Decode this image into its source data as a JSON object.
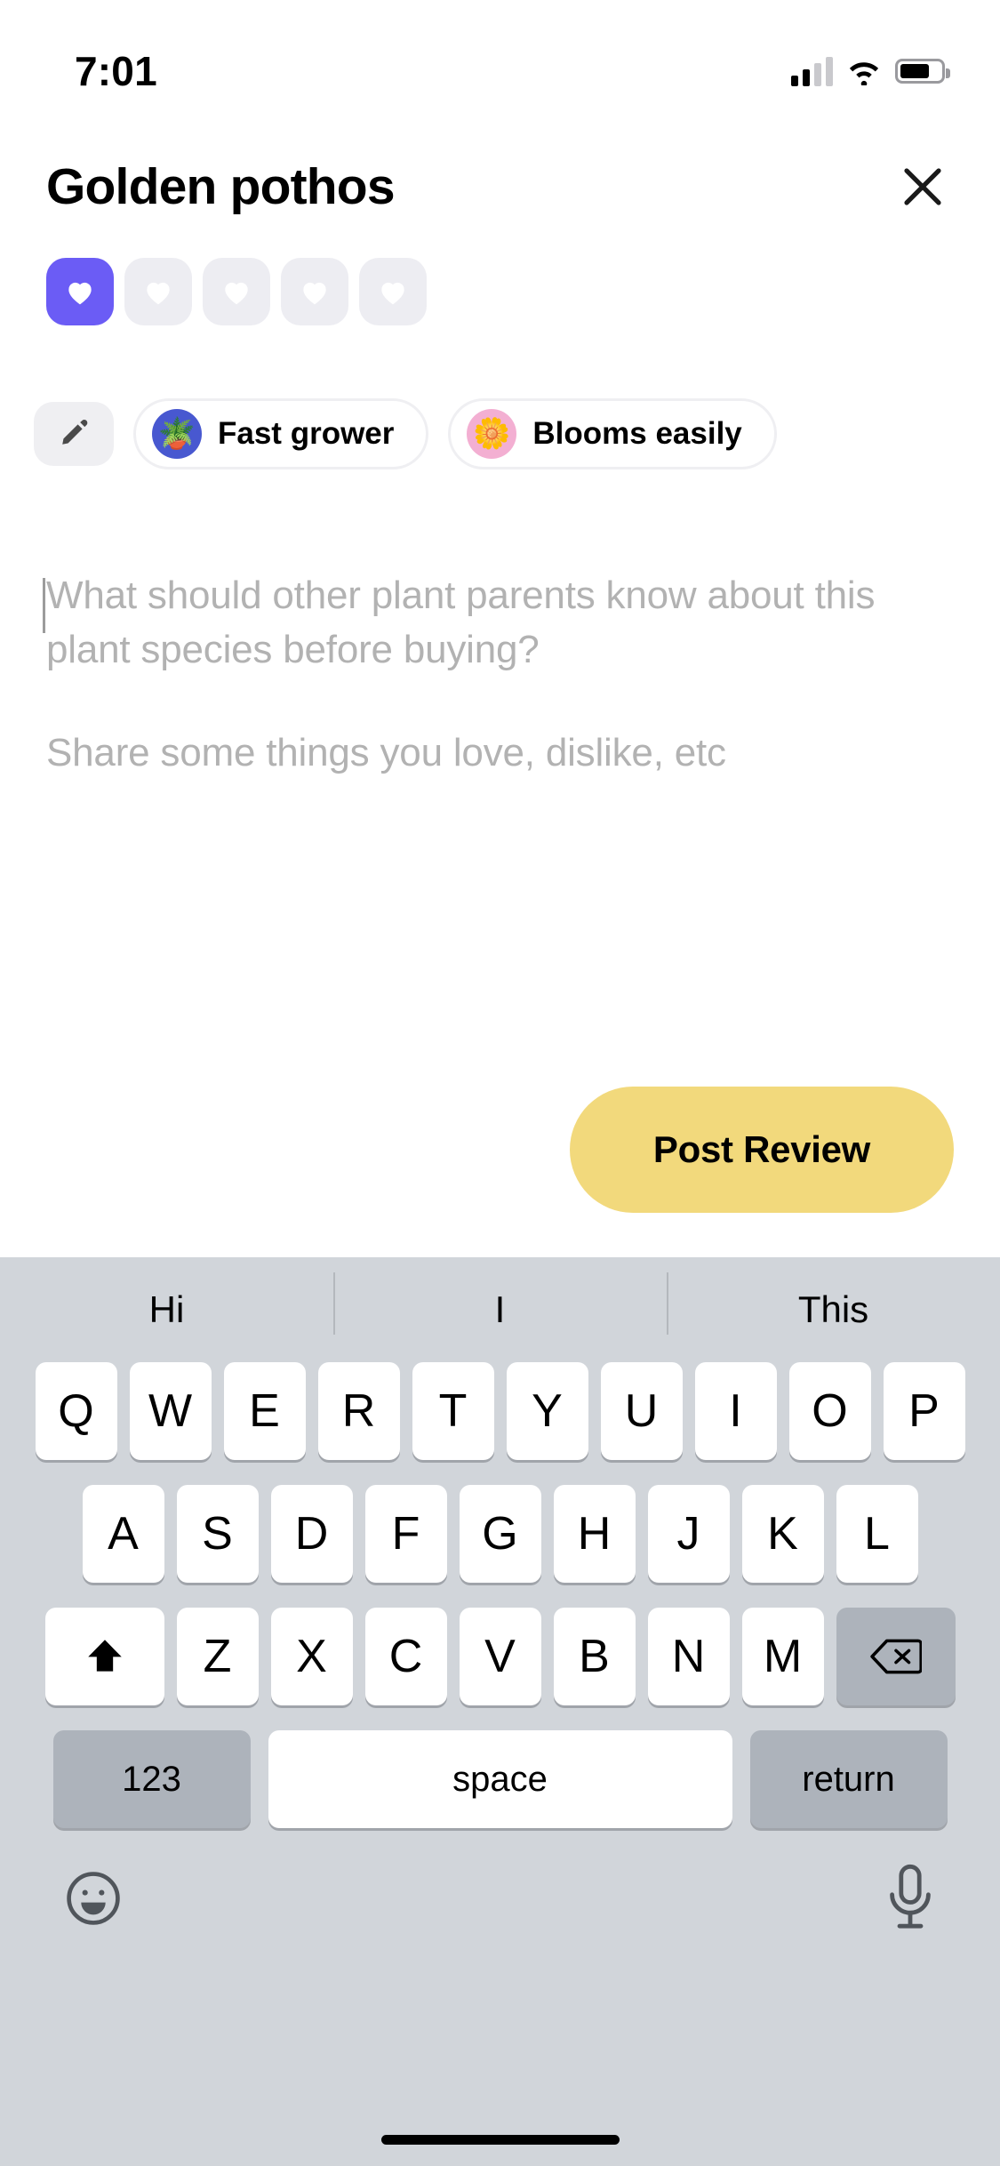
{
  "status_bar": {
    "time": "7:01",
    "cellular_icon": "cellular-signal-icon",
    "wifi_icon": "wifi-icon",
    "battery_icon": "battery-icon"
  },
  "header": {
    "title": "Golden pothos",
    "close_icon": "close-icon"
  },
  "rating": {
    "selected": 1,
    "total": 5,
    "selected_color": "#6B5CF5",
    "unselected_color": "#EDEDF2",
    "icon": "heart-icon",
    "hearts": [
      {
        "index": 1,
        "selected": true
      },
      {
        "index": 2,
        "selected": false
      },
      {
        "index": 3,
        "selected": false
      },
      {
        "index": 4,
        "selected": false
      },
      {
        "index": 5,
        "selected": false
      }
    ]
  },
  "chips": {
    "edit_icon": "pencil-icon",
    "items": [
      {
        "label": "Fast grower",
        "emoji": "🪴",
        "emoji_name": "potted-plant-icon",
        "bg": "#4858D0"
      },
      {
        "label": "Blooms easily",
        "emoji": "🌼",
        "emoji_name": "blossom-icon",
        "bg": "#F3AFD2"
      }
    ]
  },
  "review": {
    "value": "",
    "placeholder_line1": "What should other plant parents know about this plant species before buying?",
    "placeholder_line2": "Share some things you love, dislike, etc"
  },
  "post_button": {
    "label": "Post Review",
    "color": "#F2D97C"
  },
  "keyboard": {
    "suggestions": [
      "Hi",
      "I",
      "This"
    ],
    "row1": [
      "Q",
      "W",
      "E",
      "R",
      "T",
      "Y",
      "U",
      "I",
      "O",
      "P"
    ],
    "row2": [
      "A",
      "S",
      "D",
      "F",
      "G",
      "H",
      "J",
      "K",
      "L"
    ],
    "row3": [
      "Z",
      "X",
      "C",
      "V",
      "B",
      "N",
      "M"
    ],
    "shift_icon": "shift-arrow-icon",
    "backspace_icon": "backspace-icon",
    "numbers_key": "123",
    "space_key": "space",
    "return_key": "return",
    "emoji_icon": "emoji-smiley-icon",
    "mic_icon": "microphone-icon",
    "background": "#D1D5DA"
  }
}
